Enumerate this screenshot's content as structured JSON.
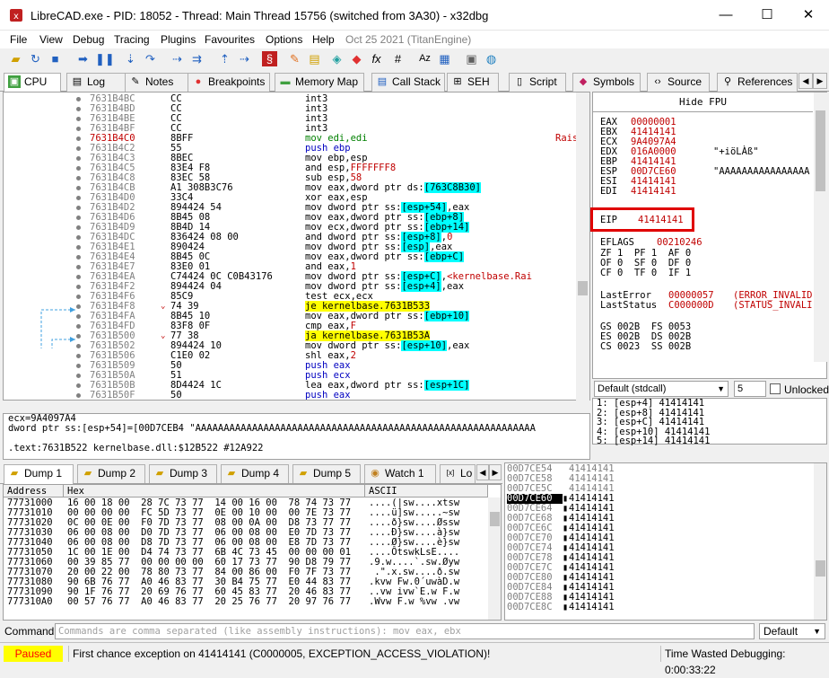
{
  "window": {
    "title": "LibreCAD.exe - PID: 18052 - Thread: Main Thread 15756 (switched from 3A30) - x32dbg",
    "minimize": "—",
    "maximize": "☐",
    "close": "✕"
  },
  "menu": [
    "File",
    "View",
    "Debug",
    "Tracing",
    "Plugins",
    "Favourites",
    "Options",
    "Help"
  ],
  "menu_date": "Oct 25 2021 (TitanEngine)",
  "tabs": [
    {
      "label": "CPU",
      "icon": "cpu-icon"
    },
    {
      "label": "Log",
      "icon": "log-icon"
    },
    {
      "label": "Notes",
      "icon": "notes-icon"
    },
    {
      "label": "Breakpoints",
      "icon": "breakpoint-icon"
    },
    {
      "label": "Memory Map",
      "icon": "memory-map-icon"
    },
    {
      "label": "Call Stack",
      "icon": "call-stack-icon"
    },
    {
      "label": "SEH",
      "icon": "seh-icon"
    },
    {
      "label": "Script",
      "icon": "script-icon"
    },
    {
      "label": "Symbols",
      "icon": "symbols-icon"
    },
    {
      "label": "Source",
      "icon": "source-icon"
    },
    {
      "label": "References",
      "icon": "references-icon"
    }
  ],
  "tab_overflow": {
    "left": "◀",
    "right": "▶"
  },
  "disasm": [
    {
      "addr": "7631B4BC",
      "bytes": "CC",
      "asm": [
        [
          "op-k",
          "int3"
        ]
      ]
    },
    {
      "addr": "7631B4BD",
      "bytes": "CC",
      "asm": [
        [
          "op-k",
          "int3"
        ]
      ]
    },
    {
      "addr": "7631B4BE",
      "bytes": "CC",
      "asm": [
        [
          "op-k",
          "int3"
        ]
      ]
    },
    {
      "addr": "7631B4BF",
      "bytes": "CC",
      "asm": [
        [
          "op-k",
          "int3"
        ]
      ]
    },
    {
      "addr": "7631B4C0",
      "bytes": "8BFF",
      "asm": [
        [
          "op-g",
          "mov edi,edi"
        ]
      ],
      "addr_red": true,
      "comment": "Rais"
    },
    {
      "addr": "7631B4C2",
      "bytes": "55",
      "asm": [
        [
          "op-b",
          "push ebp"
        ]
      ]
    },
    {
      "addr": "7631B4C3",
      "bytes": "8BEC",
      "asm": [
        [
          "op-k",
          "mov ebp,esp"
        ]
      ]
    },
    {
      "addr": "7631B4C5",
      "bytes": "83E4 F8",
      "asm": [
        [
          "op-k",
          "and esp,"
        ],
        [
          "op-r",
          "FFFFFFF8"
        ]
      ]
    },
    {
      "addr": "7631B4C8",
      "bytes": "83EC 58",
      "asm": [
        [
          "op-k",
          "sub esp,"
        ],
        [
          "op-r",
          "58"
        ]
      ]
    },
    {
      "addr": "7631B4CB",
      "bytes": "A1 308B3C76",
      "bytes_ul": true,
      "asm": [
        [
          "op-k",
          "mov eax,dword ptr ds:"
        ],
        [
          "brk",
          "[763C8B30]"
        ]
      ]
    },
    {
      "addr": "7631B4D0",
      "bytes": "33C4",
      "asm": [
        [
          "op-k",
          "xor eax,esp"
        ]
      ]
    },
    {
      "addr": "7631B4D2",
      "bytes": "894424 54",
      "asm": [
        [
          "op-k",
          "mov dword ptr ss:"
        ],
        [
          "brk",
          "[esp+54]"
        ],
        [
          "op-k",
          ",eax"
        ]
      ]
    },
    {
      "addr": "7631B4D6",
      "bytes": "8B45 08",
      "asm": [
        [
          "op-k",
          "mov eax,dword ptr ss:"
        ],
        [
          "brk",
          "[ebp+8]"
        ]
      ]
    },
    {
      "addr": "7631B4D9",
      "bytes": "8B4D 14",
      "asm": [
        [
          "op-k",
          "mov ecx,dword ptr ss:"
        ],
        [
          "brk",
          "[ebp+14]"
        ]
      ]
    },
    {
      "addr": "7631B4DC",
      "bytes": "836424 08 00",
      "asm": [
        [
          "op-k",
          "and dword ptr ss:"
        ],
        [
          "brk",
          "[esp+8]"
        ],
        [
          "op-k",
          ","
        ],
        [
          "op-r",
          "0"
        ]
      ]
    },
    {
      "addr": "7631B4E1",
      "bytes": "890424",
      "asm": [
        [
          "op-k",
          "mov dword ptr ss:"
        ],
        [
          "brk",
          "[esp]"
        ],
        [
          "op-k",
          ",eax"
        ]
      ]
    },
    {
      "addr": "7631B4E4",
      "bytes": "8B45 0C",
      "asm": [
        [
          "op-k",
          "mov eax,dword ptr ss:"
        ],
        [
          "brk",
          "[ebp+C]"
        ]
      ]
    },
    {
      "addr": "7631B4E7",
      "bytes": "83E0 01",
      "asm": [
        [
          "op-k",
          "and eax,"
        ],
        [
          "op-r",
          "1"
        ]
      ]
    },
    {
      "addr": "7631B4EA",
      "bytes": "C74424 0C C0B43176",
      "bytes_ul": true,
      "asm": [
        [
          "op-k",
          "mov dword ptr ss:"
        ],
        [
          "brk",
          "[esp+C]"
        ],
        [
          "op-k",
          ","
        ],
        [
          "op-r",
          "<kernelbase.Rai"
        ]
      ]
    },
    {
      "addr": "7631B4F2",
      "bytes": "894424 04",
      "asm": [
        [
          "op-k",
          "mov dword ptr ss:"
        ],
        [
          "brk",
          "[esp+4]"
        ],
        [
          "op-k",
          ",eax"
        ]
      ]
    },
    {
      "addr": "7631B4F6",
      "bytes": "85C9",
      "asm": [
        [
          "op-k",
          "test ecx,ecx"
        ]
      ]
    },
    {
      "addr": "7631B4F8",
      "bytes": "74 39",
      "arrow": "⌄",
      "asm": [
        [
          "hl-y",
          "je kernelbase.7631B533"
        ]
      ]
    },
    {
      "addr": "7631B4FA",
      "bytes": "8B45 10",
      "asm": [
        [
          "op-k",
          "mov eax,dword ptr ss:"
        ],
        [
          "brk",
          "[ebp+10]"
        ]
      ]
    },
    {
      "addr": "7631B4FD",
      "bytes": "83F8 0F",
      "asm": [
        [
          "op-k",
          "cmp eax,"
        ],
        [
          "op-r",
          "F"
        ]
      ]
    },
    {
      "addr": "7631B500",
      "bytes": "77 38",
      "arrow": "⌄",
      "asm": [
        [
          "hl-y",
          "ja kernelbase.7631B53A"
        ]
      ]
    },
    {
      "addr": "7631B502",
      "bytes": "894424 10",
      "asm": [
        [
          "op-k",
          "mov dword ptr ss:"
        ],
        [
          "brk",
          "[esp+10]"
        ],
        [
          "op-k",
          ",eax"
        ]
      ]
    },
    {
      "addr": "7631B506",
      "bytes": "C1E0 02",
      "asm": [
        [
          "op-k",
          "shl eax,"
        ],
        [
          "op-r",
          "2"
        ]
      ]
    },
    {
      "addr": "7631B509",
      "bytes": "50",
      "asm": [
        [
          "op-b",
          "push eax"
        ]
      ]
    },
    {
      "addr": "7631B50A",
      "bytes": "51",
      "asm": [
        [
          "op-b",
          "push ecx"
        ]
      ]
    },
    {
      "addr": "7631B50B",
      "bytes": "8D4424 1C",
      "asm": [
        [
          "op-k",
          "lea eax,dword ptr ss:"
        ],
        [
          "brk",
          "[esp+1C]"
        ]
      ]
    },
    {
      "addr": "7631B50F",
      "bytes": "50",
      "asm": [
        [
          "op-b",
          "push eax"
        ]
      ]
    }
  ],
  "hide_fpu": "Hide FPU",
  "registers": [
    {
      "name": "EAX",
      "value": "00000001",
      "comment": ""
    },
    {
      "name": "EBX",
      "value": "41414141",
      "comment": ""
    },
    {
      "name": "ECX",
      "value": "9A4097A4",
      "comment": ""
    },
    {
      "name": "EDX",
      "value": "016A0000",
      "comment": "\"+iöLÀß\""
    },
    {
      "name": "EBP",
      "value": "41414141",
      "comment": ""
    },
    {
      "name": "ESP",
      "value": "00D7CE60",
      "comment": "\"AAAAAAAAAAAAAAAA"
    },
    {
      "name": "ESI",
      "value": "41414141",
      "comment": ""
    },
    {
      "name": "EDI",
      "value": "41414141",
      "comment": ""
    }
  ],
  "eip": {
    "name": "EIP",
    "value": "41414141"
  },
  "eflags": {
    "name": "EFLAGS",
    "value": "00210246"
  },
  "flags": [
    "ZF 1  PF 1  AF 0",
    "OF 0  SF 0  DF 0",
    "CF 0  TF 0  IF 1"
  ],
  "last_error": {
    "label": "LastError",
    "value": "00000057",
    "text": "(ERROR_INVALID"
  },
  "last_status": {
    "label": "LastStatus",
    "value": "C000000D",
    "text": "(STATUS_INVALI"
  },
  "segments": [
    "GS 002B  FS 0053",
    "ES 002B  DS 002B",
    "CS 0023  SS 002B"
  ],
  "callconv": {
    "value": "Default (stdcall)",
    "argcount": "5",
    "unlocked": "Unlocked"
  },
  "stack_args": [
    "1: [esp+4] 41414141",
    "2: [esp+8] 41414141",
    "3: [esp+C] 41414141",
    "4: [esp+10] 41414141",
    "5: [esp+14] 41414141"
  ],
  "info": [
    "ecx=9A4097A4",
    "dword ptr ss:[esp+54]=[00D7CEB4 \"AAAAAAAAAAAAAAAAAAAAAAAAAAAAAAAAAAAAAAAAAAAAAAAAAAAAAAAAAAAA",
    "",
    ".text:7631B522 kernelbase.dll:$12B522 #12A922"
  ],
  "dump_tabs": [
    {
      "label": "Dump 1",
      "icon": "dump-icon"
    },
    {
      "label": "Dump 2",
      "icon": "dump-icon"
    },
    {
      "label": "Dump 3",
      "icon": "dump-icon"
    },
    {
      "label": "Dump 4",
      "icon": "dump-icon"
    },
    {
      "label": "Dump 5",
      "icon": "dump-icon"
    },
    {
      "label": "Watch 1",
      "icon": "watch-icon"
    },
    {
      "label": "Lo",
      "icon": "locals-icon"
    }
  ],
  "dump_headers": {
    "address": "Address",
    "hex": "Hex",
    "ascii": "ASCII"
  },
  "dump_rows": [
    {
      "addr": "77731000",
      "hex": "16 00 18 00  28 7C 73 77  14 00 16 00  78 74 73 77",
      "ascii": "....(|sw....xtsw"
    },
    {
      "addr": "77731010",
      "hex": "00 00 00 00  FC 5D 73 77  0E 00 10 00  00 7E 73 77",
      "ascii": "....ü]sw.....~sw"
    },
    {
      "addr": "77731020",
      "hex": "0C 00 0E 00  F0 7D 73 77  08 00 0A 00  D8 73 77 77",
      "ascii": "....ð}sw....Øssw"
    },
    {
      "addr": "77731030",
      "hex": "06 00 08 00  D0 7D 73 77  06 00 08 00  E0 7D 73 77",
      "ascii": "....Ð}sw....à}sw"
    },
    {
      "addr": "77731040",
      "hex": "06 00 08 00  D8 7D 73 77  06 00 08 00  E8 7D 73 77",
      "ascii": "....Ø}sw....è}sw"
    },
    {
      "addr": "77731050",
      "hex": "1C 00 1E 00  D4 74 73 77  6B 4C 73 45  00 00 00 01",
      "ascii": "....ÔtswkLsE...."
    },
    {
      "addr": "77731060",
      "hex": "00 39 85 77  00 00 00 00  60 17 73 77  90 D8 79 77",
      "ascii": ".9.w....`.sw.Øyw"
    },
    {
      "addr": "77731070",
      "hex": "20 00 22 00  78 80 73 77  84 00 86 00  F0 7F 73 77",
      "ascii": " .\".x.sw....ð.sw"
    },
    {
      "addr": "77731080",
      "hex": "90 6B 76 77  A0 46 83 77  30 B4 75 77  E0 44 83 77",
      "ascii": ".kvw Fw.0´uwàD.w"
    },
    {
      "addr": "77731090",
      "hex": "90 1F 76 77  20 69 76 77  60 45 83 77  20 46 83 77",
      "ascii": "..vw ivw`E.w F.w"
    },
    {
      "addr": "777310A0",
      "hex": "00 57 76 77  A0 46 83 77  20 25 76 77  20 97 76 77",
      "ascii": ".Wvw F.w %vw .vw"
    }
  ],
  "stack_rows": [
    {
      "addr": "00D7CE54",
      "val": "41414141"
    },
    {
      "addr": "00D7CE58",
      "val": "41414141"
    },
    {
      "addr": "00D7CE5C",
      "val": "41414141"
    },
    {
      "addr": "00D7CE60",
      "val": "41414141",
      "current": true
    },
    {
      "addr": "00D7CE64",
      "val": "41414141"
    },
    {
      "addr": "00D7CE68",
      "val": "41414141"
    },
    {
      "addr": "00D7CE6C",
      "val": "41414141"
    },
    {
      "addr": "00D7CE70",
      "val": "41414141"
    },
    {
      "addr": "00D7CE74",
      "val": "41414141"
    },
    {
      "addr": "00D7CE78",
      "val": "41414141"
    },
    {
      "addr": "00D7CE7C",
      "val": "41414141"
    },
    {
      "addr": "00D7CE80",
      "val": "41414141"
    },
    {
      "addr": "00D7CE84",
      "val": "41414141"
    },
    {
      "addr": "00D7CE88",
      "val": "41414141"
    },
    {
      "addr": "00D7CE8C",
      "val": "41414141"
    }
  ],
  "command": {
    "label": "Command:",
    "placeholder": "Commands are comma separated (like assembly instructions): mov eax, ebx",
    "mode": "Default"
  },
  "status": {
    "state": "Paused",
    "message": "First chance exception on 41414141 (C0000005, EXCEPTION_ACCESS_VIOLATION)!",
    "time": "Time Wasted Debugging: 0:00:33:22"
  },
  "colors": {
    "paused_bg": "#ffff00",
    "paused_fg": "#ff0000",
    "eip_box": "#e00000",
    "reg_value": "#c00000"
  }
}
